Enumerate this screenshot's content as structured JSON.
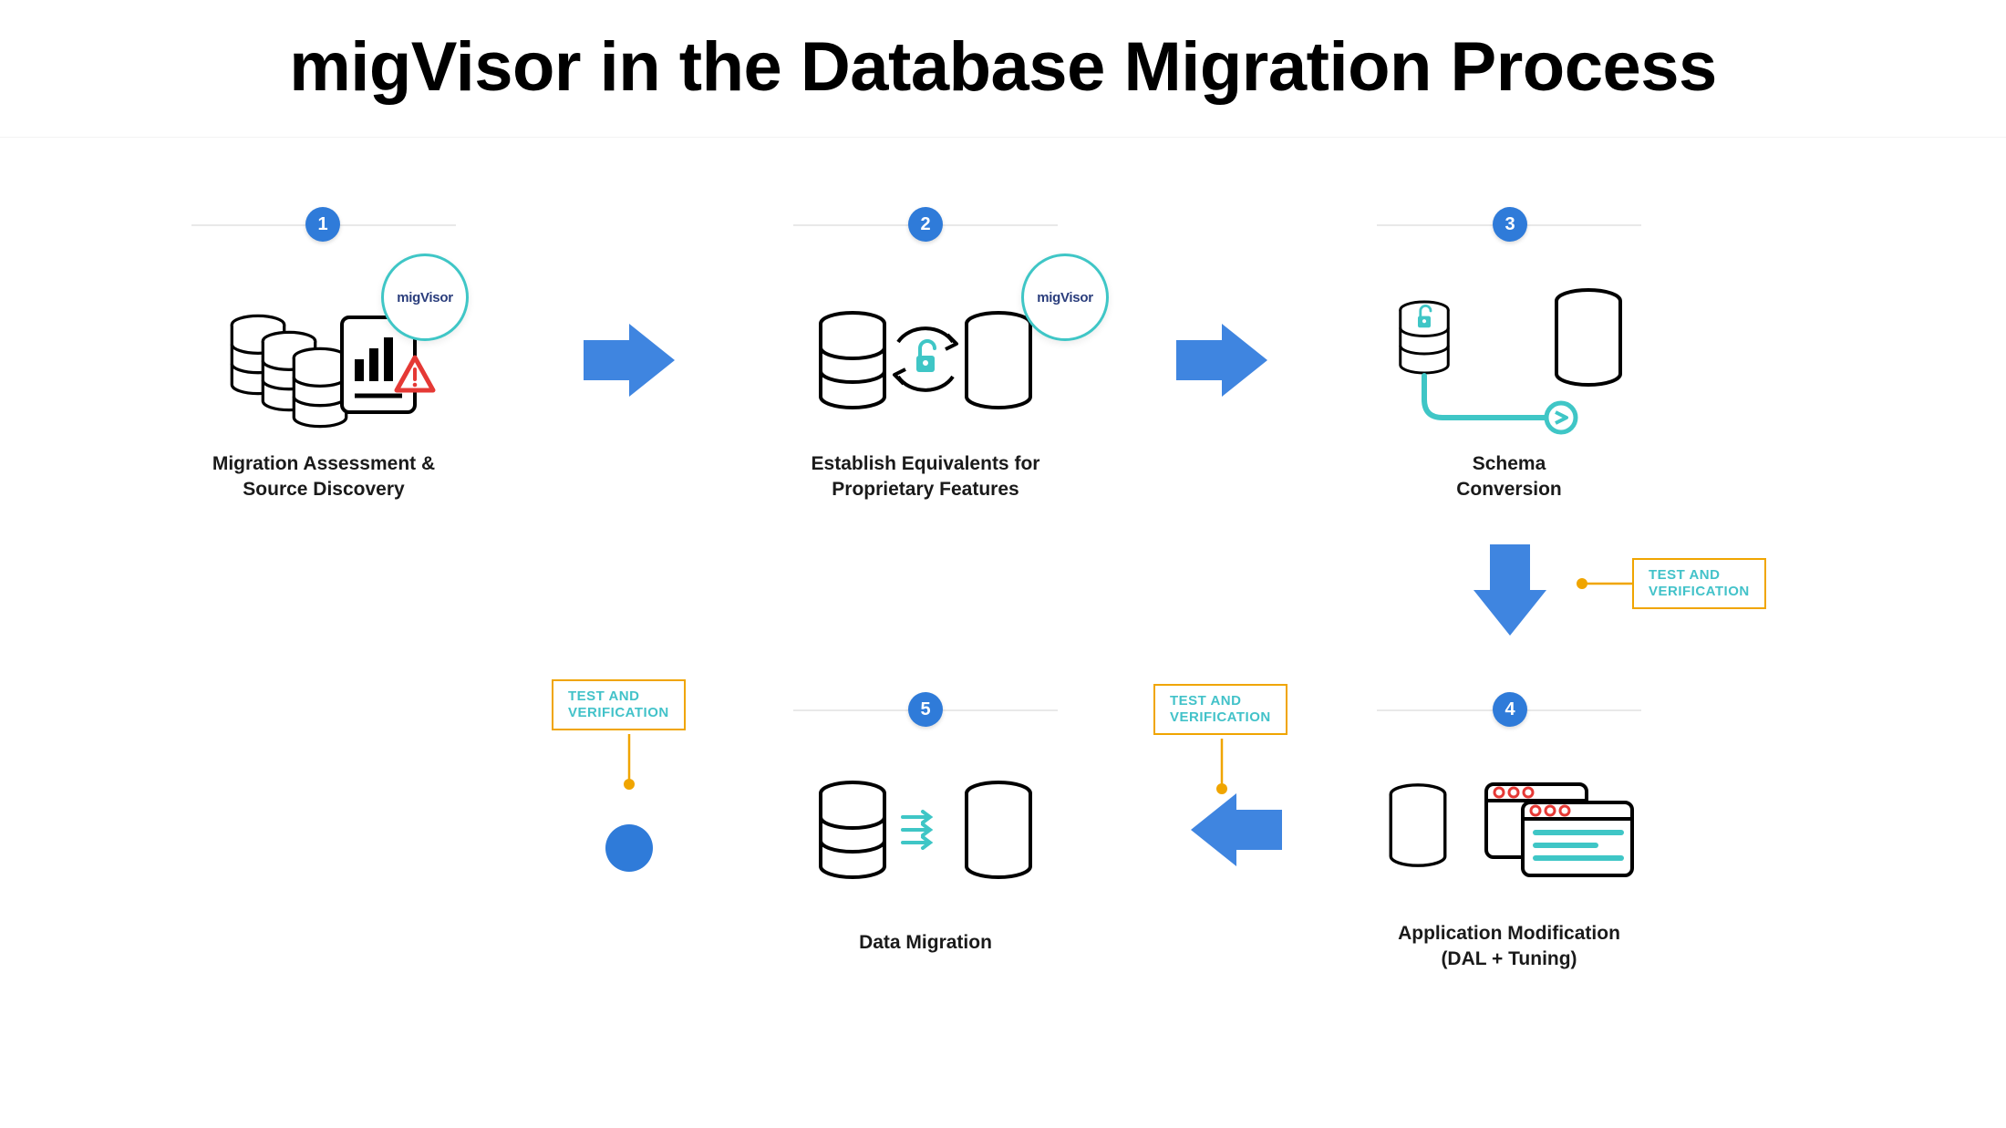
{
  "title": "migVisor in the Database Migration Process",
  "brand": "migVisor",
  "test_label_l1": "TEST AND",
  "test_label_l2": "VERIFICATION",
  "steps": {
    "s1": {
      "num": "1",
      "label_l1": "Migration Assessment &",
      "label_l2": "Source Discovery"
    },
    "s2": {
      "num": "2",
      "label_l1": "Establish Equivalents for",
      "label_l2": "Proprietary Features"
    },
    "s3": {
      "num": "3",
      "label_l1": "Schema",
      "label_l2": "Conversion"
    },
    "s4": {
      "num": "4",
      "label_l1": "Application Modification",
      "label_l2": "(DAL + Tuning)"
    },
    "s5": {
      "num": "5",
      "label_l1": "Data Migration",
      "label_l2": ""
    }
  },
  "colors": {
    "accent_blue": "#2f7bd9",
    "teal": "#3fc6c6",
    "orange": "#f0a500",
    "red": "#e53935"
  }
}
